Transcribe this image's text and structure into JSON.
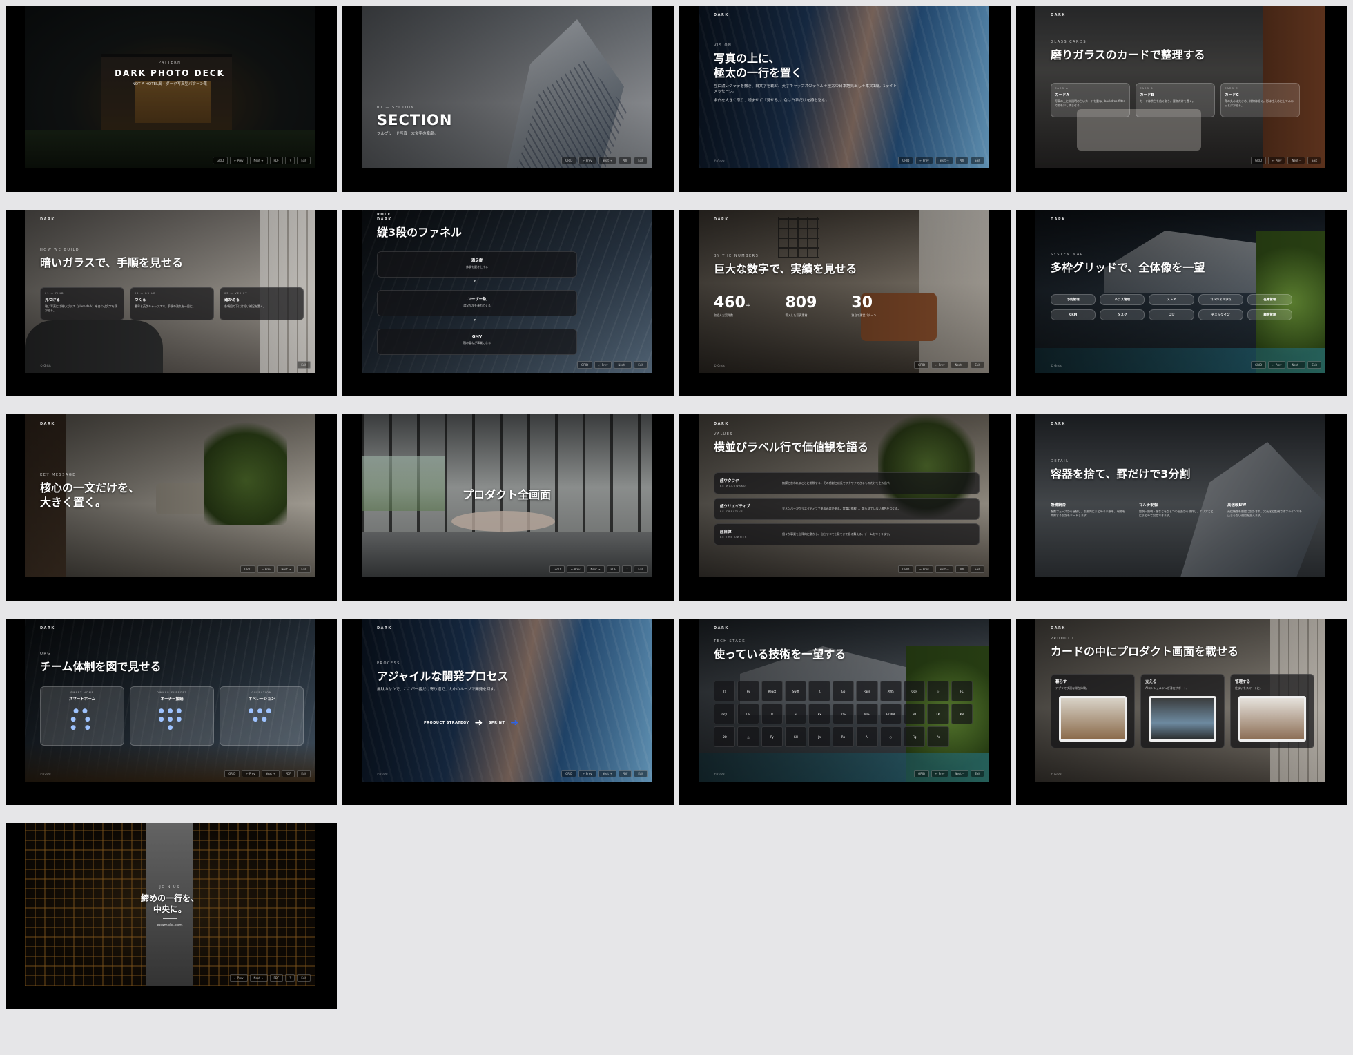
{
  "controls": [
    "GRID",
    "← Prev",
    "Next →",
    "PDF",
    "?",
    "Exit"
  ],
  "slides": {
    "s1": {
      "eyebrow": "PATTERN",
      "title": "DARK PHOTO DECK",
      "subtitle": "NOT A HOTEL風・ダーク写真型パターン集"
    },
    "s2": {
      "eyebrow": "01 — SECTION",
      "title": "SECTION",
      "subtitle": "フルブリード写真＋大文字の章扉。"
    },
    "s3": {
      "brand": "DARK",
      "eyebrow": "VISION",
      "title": "写真の上に、\n極太の一行を置く",
      "body": "左に濃いグラデを敷き、白文字を載せ、英字キャップスのラベル＋極太の日本語見出し＋本文1段。1ライトメッセージ。",
      "body2": "余白を大きく取り、読ませず「見せる」。色は白系だけを持ち込む。",
      "footer": "© Grids"
    },
    "s4": {
      "brand": "DARK",
      "eyebrow": "GLASS CARDS",
      "title": "磨りガラスのカードで整理する",
      "cards": [
        {
          "k": "CARD A",
          "t": "カードA",
          "x": "写真の上に半透明の白いカードを重ね、backdrop-filterで奥を少し滲ませる。"
        },
        {
          "k": "CARD B",
          "t": "カードB",
          "x": "カードは余白を広く取り、要点だけを置く。"
        },
        {
          "k": "CARD C",
          "t": "カードC",
          "x": "角の丸みは大きめ、枠線は細く。影は控えめにしてふわっと浮かせる。"
        }
      ]
    },
    "s5": {
      "brand": "DARK",
      "eyebrow": "HOW WE BUILD",
      "title": "暗いガラスで、手順を見せる",
      "steps": [
        {
          "k": "01 — FIND",
          "t": "見つける",
          "x": "暗い写真には暗いガラス（glass-dark）を合わせ文字を浮かせる。"
        },
        {
          "k": "02 — BUILD",
          "t": "つくる",
          "x": "番号と英字キャップスで、手順の流れを一目に。"
        },
        {
          "k": "03 — VERIFY",
          "t": "確かめる",
          "x": "各項目の下には短い補足を置く。"
        }
      ],
      "footer": "© Grids"
    },
    "s6": {
      "brand": "DARK",
      "eyebrow": "ROLE",
      "title": "縦3段のファネル",
      "stages": [
        {
          "t": "満足度",
          "x": "体験を磨き上げる"
        },
        {
          "t": "ユーザー数",
          "x": "満足が次を連れてくる"
        },
        {
          "t": "GMV",
          "x": "積み重ねが事業になる"
        }
      ]
    },
    "s7": {
      "brand": "DARK",
      "eyebrow": "BY THE NUMBERS",
      "title": "巨大な数字で、実績を見せる",
      "stats": [
        {
          "n": "460",
          "suffix": "+",
          "l": "取組んだ案件数"
        },
        {
          "n": "809",
          "suffix": "",
          "l": "導入した写真素材"
        },
        {
          "n": "30",
          "suffix": "",
          "l": "独自の運営パターン"
        }
      ],
      "footer": "© Grids"
    },
    "s8": {
      "brand": "DARK",
      "eyebrow": "SYSTEM MAP",
      "title": "多枠グリッドで、全体像を一望",
      "chips": [
        "予約管理",
        "ハウス管理",
        "ストア",
        "コンシェルジュ",
        "在庫管理",
        "CRM",
        "タスク",
        "ロジ",
        "チェックイン",
        "顧客管理"
      ],
      "footer": "© Grids"
    },
    "s9": {
      "brand": "DARK",
      "eyebrow": "KEY MESSAGE",
      "title": "核心の一文だけを、\n大きく置く。"
    },
    "s10": {
      "title": "プロダクト全画面"
    },
    "s11": {
      "brand": "DARK",
      "eyebrow": "VALUES",
      "title": "横並びラベル行で価値観を語る",
      "rows": [
        {
          "t": "超ワクワク",
          "k": "BE WAKUWAKU",
          "x": "無謀と言われることに挑戦する。その感謝と成長でワクワクできるものだけを生み出す。"
        },
        {
          "t": "超クリエイティブ",
          "k": "BE CREATIVE",
          "x": "全メンバーがクリエイティブである必要がある。常識に挑戦し、誰も見ていない景色をつくる。"
        },
        {
          "t": "超自律",
          "k": "BE THE OWNER",
          "x": "個々が事業を自律的に動かし、自らすべてを見てきて振る舞える。チームをつくります。"
        }
      ]
    },
    "s12": {
      "brand": "DARK",
      "eyebrow": "DETAIL",
      "title": "容器を捨て、罫だけで3分割",
      "cols": [
        {
          "t": "設備統合",
          "x": "複数フェーズから接続し、設備内にまとめる手順を、現場を実際する設計をリードします。"
        },
        {
          "t": "マルチ制御",
          "x": "空調・照明・鍵などをひとつの画面から操作し、エリアごとにまとめて設定できます。"
        },
        {
          "t": "高信頼NW",
          "x": "高信頼性を前提に設計され、冗長化と監視でオフラインでも止まらない運用を支えます。"
        }
      ]
    },
    "s13": {
      "brand": "DARK",
      "eyebrow": "ORG",
      "title": "チーム体制を図で見せる",
      "teams": [
        {
          "k": "SMART HOME",
          "t": "スマートホーム"
        },
        {
          "k": "OWNER SUPPORT",
          "t": "オーナー接続"
        },
        {
          "k": "OPERATION",
          "t": "オペレーション"
        }
      ],
      "footer": "© Grids"
    },
    "s14": {
      "brand": "DARK",
      "eyebrow": "PROCESS",
      "title": "アジャイルな開発プロセス",
      "body": "無駄のなかで、ここが一番だけ寄り道で、大小のループで開発を回す。",
      "flow": [
        "PRODUCT STRATEGY",
        "SPRINT"
      ],
      "footer": "© Grids"
    },
    "s15": {
      "brand": "DARK",
      "eyebrow": "TECH STACK",
      "title": "使っている技術を一望する",
      "tiles": [
        "TS",
        "Py",
        "React",
        "Swift",
        "K",
        "Go",
        "Rails",
        "AWS",
        "GCP",
        "☆",
        "FL",
        "GQL",
        "DR",
        "Ts",
        "⚡",
        "Ex",
        "iOS",
        "VUE",
        "FIGMA",
        "NX",
        "LK",
        "K8",
        "DO",
        "△",
        "Py",
        "GH",
        "Jn",
        "Rb",
        "Ai",
        "○",
        "Fig",
        "Ps"
      ],
      "footer": "© Grids"
    },
    "s16": {
      "brand": "DARK",
      "eyebrow": "PRODUCT",
      "title": "カードの中にプロダクト画面を載せる",
      "cards": [
        {
          "t": "暮らす",
          "x": "アプリで快適な滞在体験。"
        },
        {
          "t": "支える",
          "x": "AIコンシェルジュが滞在サポート。"
        },
        {
          "t": "管理する",
          "x": "住まいをスマートに。"
        }
      ],
      "footer": "© Grids"
    },
    "s17": {
      "eyebrow": "JOIN US",
      "title": "締めの一行を、\n中央に。",
      "url": "example.com"
    }
  },
  "colors": {
    "accent_blue": "#2e63e6"
  }
}
